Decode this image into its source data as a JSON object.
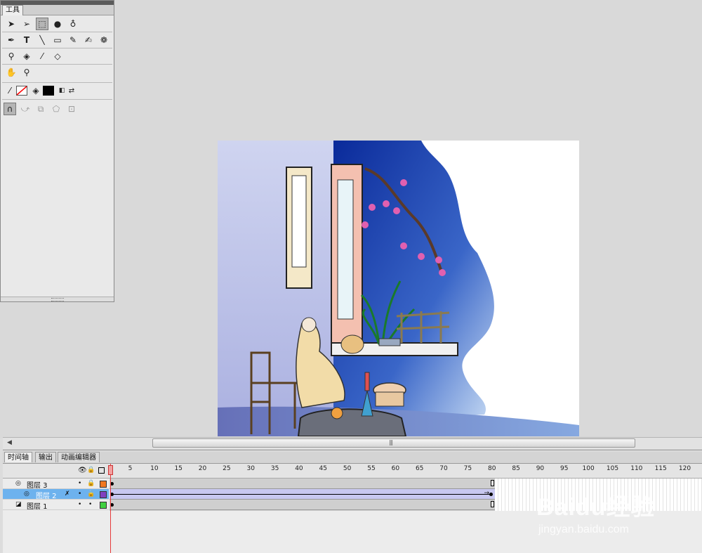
{
  "tools_panel": {
    "tab_label": "工具"
  },
  "timeline": {
    "tabs": [
      "时间轴",
      "输出",
      "动画编辑器"
    ],
    "ruler": [
      1,
      5,
      10,
      15,
      20,
      25,
      30,
      35,
      40,
      45,
      50,
      55,
      60,
      65,
      70,
      75,
      80,
      85,
      90,
      95,
      100,
      105,
      110,
      115,
      120
    ],
    "layers": [
      {
        "name": "图层 3",
        "color": "#f07820",
        "selected": false
      },
      {
        "name": "图层 2",
        "color": "#8040c0",
        "selected": true
      },
      {
        "name": "图层 1",
        "color": "#40d040",
        "selected": false
      }
    ],
    "current_frame": 1,
    "last_frame": 80
  },
  "watermark": {
    "logo": "Baidu经验",
    "url": "jingyan.baidu.com"
  },
  "colors": {
    "stroke_color": "#ff0000",
    "fill_color": "#000000"
  }
}
